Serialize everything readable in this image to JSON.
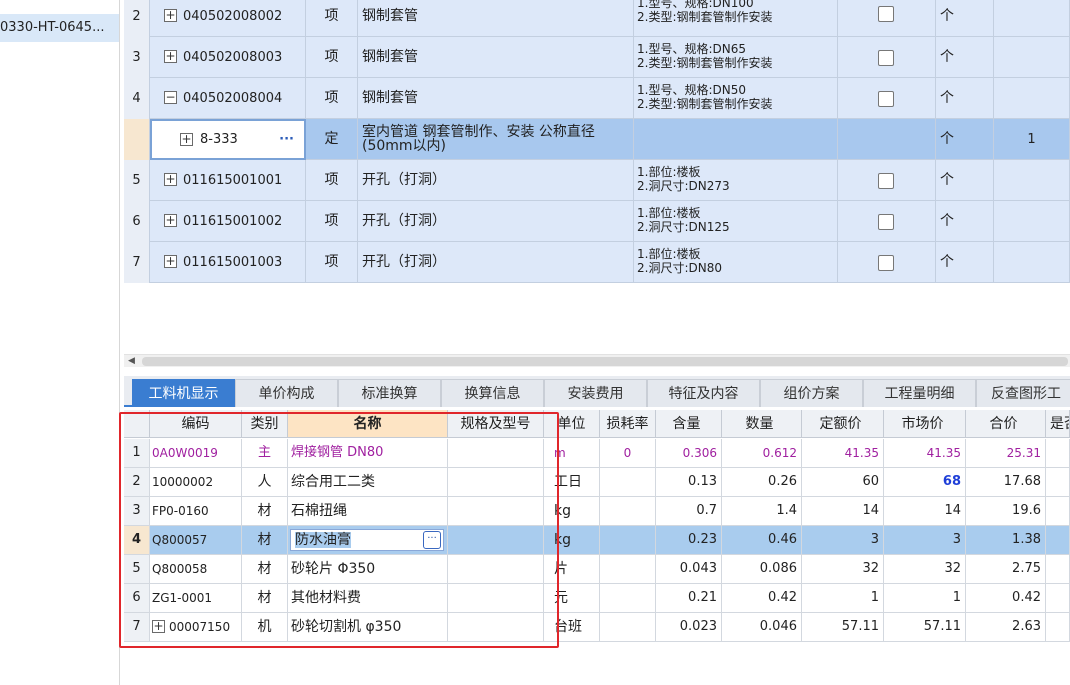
{
  "sidebar": {
    "selected_item": "0330-HT-0645..."
  },
  "upper_rows": [
    {
      "num": "2",
      "code": "040502008002",
      "kind": "项",
      "name": "钢制套管",
      "feature_lines": [
        "1.型号、规格:DN100",
        "2.类型:钢制套管制作安装"
      ],
      "unit": "个",
      "qty": ""
    },
    {
      "num": "3",
      "code": "040502008003",
      "kind": "项",
      "name": "钢制套管",
      "feature_lines": [
        "1.型号、规格:DN65",
        "2.类型:钢制套管制作安装"
      ],
      "unit": "个",
      "qty": ""
    },
    {
      "num": "4",
      "code": "040502008004",
      "kind": "项",
      "name": "钢制套管",
      "feature_lines": [
        "1.型号、规格:DN50",
        "2.类型:钢制套管制作安装"
      ],
      "unit": "个",
      "qty": ""
    },
    {
      "num": "",
      "code": "8-333",
      "kind": "定",
      "name": "室内管道 钢套管制作、安装 公称直径(50mm以内)",
      "feature_lines": [
        "",
        ""
      ],
      "unit": "个",
      "qty": "1"
    },
    {
      "num": "5",
      "code": "011615001001",
      "kind": "项",
      "name": "开孔（打洞）",
      "feature_lines": [
        "1.部位:楼板",
        "2.洞尺寸:DN273"
      ],
      "unit": "个",
      "qty": ""
    },
    {
      "num": "6",
      "code": "011615001002",
      "kind": "项",
      "name": "开孔（打洞）",
      "feature_lines": [
        "1.部位:楼板",
        "2.洞尺寸:DN125"
      ],
      "unit": "个",
      "qty": ""
    },
    {
      "num": "7",
      "code": "011615001003",
      "kind": "项",
      "name": "开孔（打洞）",
      "feature_lines": [
        "1.部位:楼板",
        "2.洞尺寸:DN80"
      ],
      "unit": "个",
      "qty": ""
    }
  ],
  "tabs": [
    "工料机显示",
    "单价构成",
    "标准换算",
    "换算信息",
    "安装费用",
    "特征及内容",
    "组价方案",
    "工程量明细",
    "反查图形工"
  ],
  "active_tab": "工料机显示",
  "lower_headers": [
    "编码",
    "类别",
    "名称",
    "规格及型号",
    "单位",
    "损耗率",
    "含量",
    "数量",
    "定额价",
    "市场价",
    "合价",
    "是否"
  ],
  "lower_rows": [
    {
      "num": "1",
      "code": "0A0W0019",
      "type": "主",
      "name": "焊接钢管 DN80",
      "spec": "",
      "unit": "m",
      "loss": "0",
      "content": "0.306",
      "amount": "0.612",
      "quota": "41.35",
      "market": "41.35",
      "total": "25.31"
    },
    {
      "num": "2",
      "code": "10000002",
      "type": "人",
      "name": "综合用工二类",
      "spec": "",
      "unit": "工日",
      "loss": "",
      "content": "0.13",
      "amount": "0.26",
      "quota": "60",
      "market": "68",
      "total": "17.68"
    },
    {
      "num": "3",
      "code": "FP0-0160",
      "type": "材",
      "name": "石棉扭绳",
      "spec": "",
      "unit": "kg",
      "loss": "",
      "content": "0.7",
      "amount": "1.4",
      "quota": "14",
      "market": "14",
      "total": "19.6"
    },
    {
      "num": "4",
      "code": "Q800057",
      "type": "材",
      "name": "防水油膏",
      "spec": "",
      "unit": "kg",
      "loss": "",
      "content": "0.23",
      "amount": "0.46",
      "quota": "3",
      "market": "3",
      "total": "1.38"
    },
    {
      "num": "5",
      "code": "Q800058",
      "type": "材",
      "name": "砂轮片 Φ350",
      "spec": "",
      "unit": "片",
      "loss": "",
      "content": "0.043",
      "amount": "0.086",
      "quota": "32",
      "market": "32",
      "total": "2.75"
    },
    {
      "num": "6",
      "code": "ZG1-0001",
      "type": "材",
      "name": "其他材料费",
      "spec": "",
      "unit": "元",
      "loss": "",
      "content": "0.21",
      "amount": "0.42",
      "quota": "1",
      "market": "1",
      "total": "0.42"
    },
    {
      "num": "7",
      "code": "00007150",
      "type": "机",
      "name": "砂轮切割机 φ350",
      "spec": "",
      "unit": "台班",
      "loss": "",
      "content": "0.023",
      "amount": "0.046",
      "quota": "57.11",
      "market": "57.11",
      "total": "2.63"
    }
  ],
  "glyphs": {
    "expand": "+",
    "collapse": "−",
    "more": "···",
    "left_arrow": "◀"
  },
  "colors": {
    "accent": "#3a7dd1",
    "selected_row": "#a9ccee",
    "main_material": "#a020a0",
    "edited_value": "#1f3fd8",
    "highlight_box": "#e0262b"
  }
}
